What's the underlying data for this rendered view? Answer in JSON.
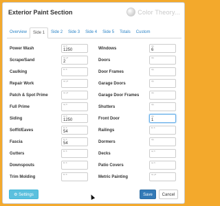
{
  "dialog": {
    "title": "Exterior Paint Section",
    "logo_text": "Color Theory..."
  },
  "tabs": [
    "Overview",
    "Side 1",
    "Side 2",
    "Side 3",
    "Side 4",
    "Side 5",
    "Totals",
    "Custom"
  ],
  "active_tab": "Side 1",
  "left_fields": [
    {
      "label": "Power Wash",
      "unit": "sq ft",
      "value": "1250"
    },
    {
      "label": "Scrape/Sand",
      "unit": "sq yd",
      "value": "2"
    },
    {
      "label": "Caulking",
      "unit": "lin ft",
      "value": ""
    },
    {
      "label": "Repair Work",
      "unit": "sq yd",
      "value": ""
    },
    {
      "label": "Patch & Spot Prime",
      "unit": "sq yd",
      "value": ""
    },
    {
      "label": "Full Prime",
      "unit": "sq ft",
      "value": ""
    },
    {
      "label": "Siding",
      "unit": "sq ft",
      "value": "1250"
    },
    {
      "label": "Soffit/Eaves",
      "unit": "lin ft",
      "value": "54"
    },
    {
      "label": "Fascia",
      "unit": "lin ft",
      "value": "54"
    },
    {
      "label": "Gutters",
      "unit": "lin ft",
      "value": ""
    },
    {
      "label": "Downspouts",
      "unit": "lin ft",
      "value": ""
    },
    {
      "label": "Trim Molding",
      "unit": "lin ft",
      "value": ""
    }
  ],
  "right_fields": [
    {
      "label": "Windows",
      "unit": "qty",
      "value": "6"
    },
    {
      "label": "Doors",
      "unit": "qty",
      "value": ""
    },
    {
      "label": "Door Frames",
      "unit": "qty",
      "value": ""
    },
    {
      "label": "Garage Doors",
      "unit": "qty",
      "value": ""
    },
    {
      "label": "Garage Door Frames",
      "unit": "qty",
      "value": ""
    },
    {
      "label": "Shutters",
      "unit": "qty",
      "value": ""
    },
    {
      "label": "Front Door",
      "unit": "qty",
      "value": "1"
    },
    {
      "label": "Railings",
      "unit": "lin ft",
      "value": ""
    },
    {
      "label": "Dormers",
      "unit": "qty",
      "value": ""
    },
    {
      "label": "Decks",
      "unit": "sq ft",
      "value": ""
    },
    {
      "label": "Patio Covers",
      "unit": "sq ft",
      "value": ""
    },
    {
      "label": "Metric Painting",
      "unit": "sq yd",
      "value": ""
    }
  ],
  "focused_field": "Front Door",
  "buttons": {
    "settings": "⚙ Settings",
    "save": "Save",
    "cancel": "Cancel"
  },
  "colors": {
    "frame": "#f3a92c",
    "tab_link": "#2a83c6",
    "settings_button": "#5bc0de",
    "save_button": "#337ab7"
  }
}
